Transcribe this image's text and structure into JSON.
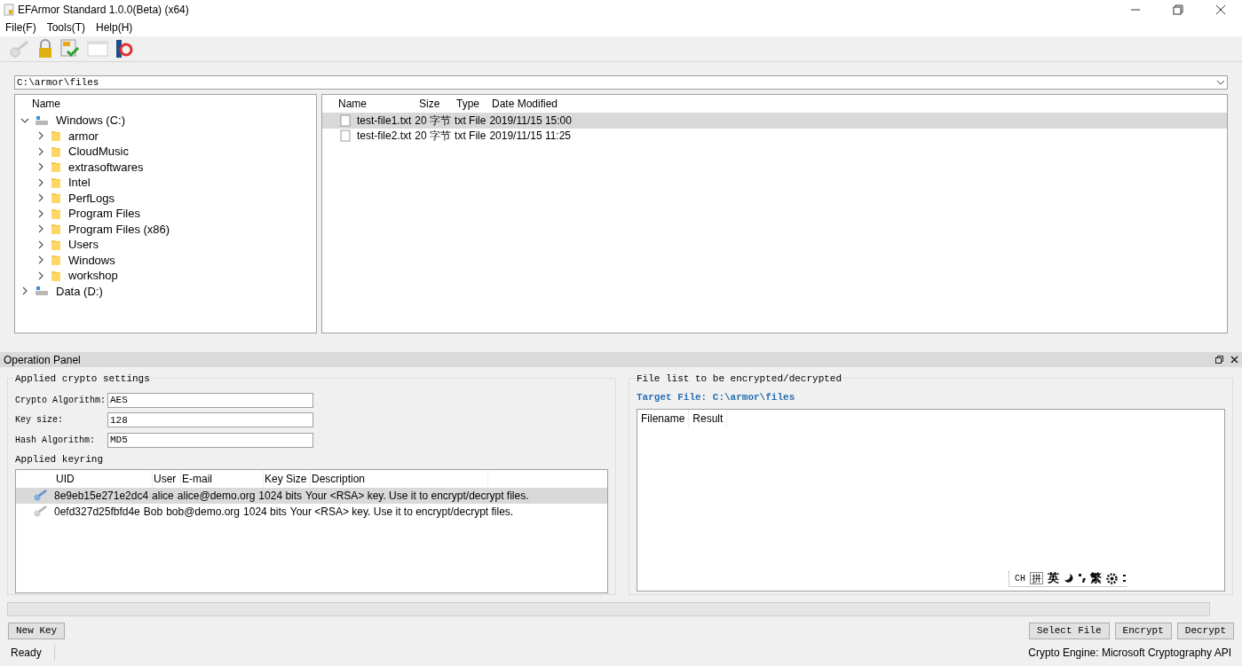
{
  "window": {
    "title": "EFArmor Standard 1.0.0(Beta) (x64)"
  },
  "menu": [
    "File(F)",
    "Tools(T)",
    "Help(H)"
  ],
  "path_field": {
    "value": "C:\\armor\\files"
  },
  "tree": {
    "column": "Name",
    "items": [
      {
        "label": "Windows (C:)",
        "kind": "drive",
        "expanded": true,
        "children": [
          {
            "label": "armor",
            "kind": "folder",
            "expanded": false
          },
          {
            "label": "CloudMusic",
            "kind": "folder",
            "expanded": false
          },
          {
            "label": "extrasoftwares",
            "kind": "folder",
            "expanded": false
          },
          {
            "label": "Intel",
            "kind": "folder",
            "expanded": false
          },
          {
            "label": "PerfLogs",
            "kind": "folder",
            "expanded": false
          },
          {
            "label": "Program Files",
            "kind": "folder",
            "expanded": false
          },
          {
            "label": "Program Files (x86)",
            "kind": "folder",
            "expanded": false
          },
          {
            "label": "Users",
            "kind": "folder",
            "expanded": false
          },
          {
            "label": "Windows",
            "kind": "folder",
            "expanded": false
          },
          {
            "label": "workshop",
            "kind": "folder",
            "expanded": false
          }
        ]
      },
      {
        "label": "Data (D:)",
        "kind": "drive",
        "expanded": false
      }
    ]
  },
  "files": {
    "columns": [
      "Name",
      "Size",
      "Type",
      "Date Modified"
    ],
    "rows": [
      {
        "cells": [
          "test-file1.txt",
          "20 字节",
          "txt File",
          "2019/11/15 15:00"
        ],
        "selected": true
      },
      {
        "cells": [
          "test-file2.txt",
          "20 字节",
          "txt File",
          "2019/11/15 11:25"
        ],
        "selected": false
      }
    ]
  },
  "operation_panel": {
    "title": "Operation Panel",
    "settings": {
      "title": "Applied crypto settings",
      "fields": [
        {
          "label": "Crypto Algorithm:",
          "value": "AES"
        },
        {
          "label": "Key size:",
          "value": "128"
        },
        {
          "label": "Hash Algorithm:",
          "value": "MD5"
        }
      ]
    },
    "keyring": {
      "title": "Applied keyring",
      "columns": [
        "UID",
        "User",
        "E-mail",
        "Key Size",
        "Description"
      ],
      "rows": [
        {
          "cells": [
            "8e9eb15e271e2dc4",
            "alice",
            "alice@demo.org",
            "1024 bits",
            "Your <RSA> key. Use it to encrypt/decrypt files."
          ],
          "selected": true
        },
        {
          "cells": [
            "0efd327d25fbfd4e",
            "Bob",
            "bob@demo.org",
            "1024 bits",
            "Your <RSA> key. Use it to encrypt/decrypt files."
          ],
          "selected": false
        }
      ]
    },
    "file_list": {
      "title": "File list to be encrypted/decrypted",
      "target": "Target File: C:\\armor\\files",
      "columns": [
        "Filename",
        "Result"
      ]
    },
    "progress": {
      "level": 0
    },
    "buttons_left": [
      "New Key"
    ],
    "buttons_right": [
      "Select File",
      "Encrypt",
      "Decrypt"
    ]
  },
  "ime_bar": {
    "items": [
      "CH",
      "拼",
      "英",
      "繁"
    ]
  },
  "status_bar": {
    "left": "Ready",
    "right": "Crypto Engine: Microsoft Cryptography API"
  }
}
